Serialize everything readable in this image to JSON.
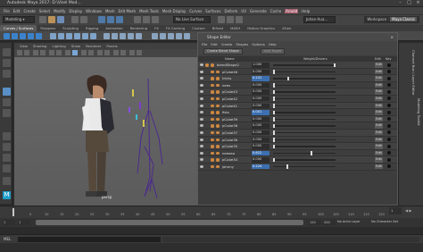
{
  "window": {
    "title": "Autodesk Maya 2017: D:\\Visel Mod..."
  },
  "menubar": {
    "items": [
      "File",
      "Edit",
      "Create",
      "Select",
      "Modify",
      "Display",
      "Windows",
      "Mesh",
      "Edit Mesh",
      "Mesh Tools",
      "Mesh Display",
      "Curves",
      "Surfaces",
      "Deform",
      "UV",
      "Generate",
      "Cache",
      "Arnold",
      "Help"
    ],
    "highlight": "Arnold"
  },
  "toolbar": {
    "mode": "Modeling",
    "live_surface": "No Live Surface",
    "user": "Johan Hua...",
    "workspace_label": "Workspace :",
    "workspace_value": "Maya Classic"
  },
  "shelf": {
    "tabs": [
      "Curves / Surfaces",
      "Polygons",
      "Sculpting",
      "Rigging",
      "Animation",
      "Rendering",
      "FX",
      "FX Caching",
      "Custom",
      "Bifrost",
      "MASH",
      "Motion Graphics",
      "XGen"
    ],
    "active": "Curves / Surfaces"
  },
  "viewport": {
    "menu": [
      "View",
      "Shading",
      "Lighting",
      "Show",
      "Renderer",
      "Panels"
    ],
    "camera_label": "persp"
  },
  "right_panel": {
    "channel_box": "Channel Box / Layer Editor",
    "modeling_toolkit": "Modeling Toolkit"
  },
  "shape_editor": {
    "title": "Shape Editor",
    "menu": [
      "File",
      "Edit",
      "Create",
      "Shapes",
      "Options",
      "Help"
    ],
    "buttons": {
      "create": "Create Blend Shape",
      "add": "Add Target"
    },
    "headers": {
      "name": "Name",
      "weight": "Weight/Drivers",
      "edit": "Edit",
      "key": "Key"
    },
    "edit_label": "Edit",
    "rows": [
      {
        "name": "blendShape2",
        "value": "1.000",
        "level": 1.0,
        "highlight": false,
        "top": true
      },
      {
        "name": "pCube46",
        "value": "0.000",
        "level": 0.0,
        "highlight": false
      },
      {
        "name": "tricks",
        "value": "0.231",
        "level": 0.23,
        "highlight": true
      },
      {
        "name": "nees",
        "value": "0.000",
        "level": 0.0,
        "highlight": false
      },
      {
        "name": "pCube43",
        "value": "0.000",
        "level": 0.0,
        "highlight": false
      },
      {
        "name": "pCube42",
        "value": "0.000",
        "level": 0.0,
        "highlight": false
      },
      {
        "name": "pCube41",
        "value": "0.000",
        "level": 0.0,
        "highlight": false
      },
      {
        "name": "fists",
        "value": "0.001",
        "level": 0.0,
        "highlight": true
      },
      {
        "name": "pCube39",
        "value": "0.000",
        "level": 0.0,
        "highlight": false
      },
      {
        "name": "pCube38",
        "value": "0.000",
        "level": 0.0,
        "highlight": false
      },
      {
        "name": "pCube37",
        "value": "0.000",
        "level": 0.0,
        "highlight": false
      },
      {
        "name": "pCube36",
        "value": "0.000",
        "level": 0.0,
        "highlight": false
      },
      {
        "name": "pCube35",
        "value": "0.000",
        "level": 0.0,
        "highlight": false
      },
      {
        "name": "neeeeo",
        "value": "0.622",
        "level": 0.62,
        "highlight": true
      },
      {
        "name": "pCube34",
        "value": "0.000",
        "level": 0.0,
        "highlight": false
      },
      {
        "name": "johnny",
        "value": "0.224",
        "level": 0.22,
        "highlight": true
      }
    ]
  },
  "timeline": {
    "ticks": [
      "5",
      "10",
      "15",
      "20",
      "25",
      "30",
      "35",
      "40",
      "45",
      "50",
      "55",
      "60",
      "65",
      "70",
      "75",
      "80",
      "85",
      "90",
      "95",
      "100",
      "105",
      "110",
      "115",
      "120"
    ],
    "start": "1",
    "end": "120",
    "range_start": "1",
    "range_end": "120",
    "range_max": "200",
    "current_frame": "1",
    "anim_layer": "No Anim Layer",
    "char_set": "No Character Set"
  },
  "mel_label": "MEL",
  "colors": {
    "highlight": "#3c6fb0",
    "arnold": "#a25a68",
    "active_tool": "#5a90c8"
  }
}
